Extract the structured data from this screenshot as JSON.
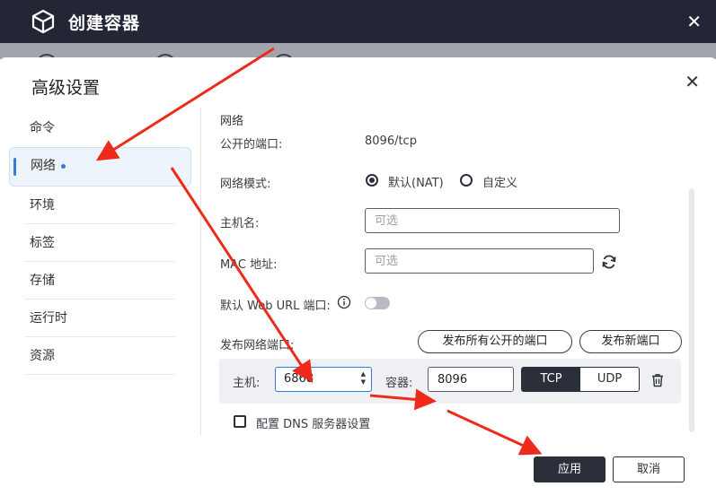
{
  "window": {
    "title": "创建容器"
  },
  "dialog": {
    "title": "高级设置"
  },
  "sidebar": {
    "items": [
      {
        "label": "命令"
      },
      {
        "label": "网络"
      },
      {
        "label": "环境"
      },
      {
        "label": "标签"
      },
      {
        "label": "存储"
      },
      {
        "label": "运行时"
      },
      {
        "label": "资源"
      }
    ],
    "active_index": 1
  },
  "network": {
    "section_title": "网络",
    "published_ports_label": "公开的端口:",
    "published_ports_value": "8096/tcp",
    "mode_label": "网络模式:",
    "mode_options": [
      "默认(NAT)",
      "自定义"
    ],
    "mode_selected": "默认(NAT)",
    "hostname_label": "主机名:",
    "hostname_placeholder": "可选",
    "mac_label": "MAC 地址:",
    "mac_placeholder": "可选",
    "web_url_label": "默认 Web URL 端口:",
    "web_url_enabled": false,
    "publish_label": "发布网络端口:",
    "publish_all_button": "发布所有公开的端口",
    "publish_new_button": "发布新端口",
    "port_mapping": {
      "host_label": "主机:",
      "host_value": "6868",
      "container_label": "容器:",
      "container_value": "8096",
      "protocols": [
        "TCP",
        "UDP"
      ],
      "selected_protocol": "TCP"
    },
    "dns_label": "配置 DNS 服务器设置",
    "dns_checked": false
  },
  "footer": {
    "apply": "应用",
    "cancel": "取消"
  },
  "colors": {
    "dark": "#2b2f3a",
    "accent": "#2f7dd6",
    "annotation": "#ee2a1b"
  }
}
